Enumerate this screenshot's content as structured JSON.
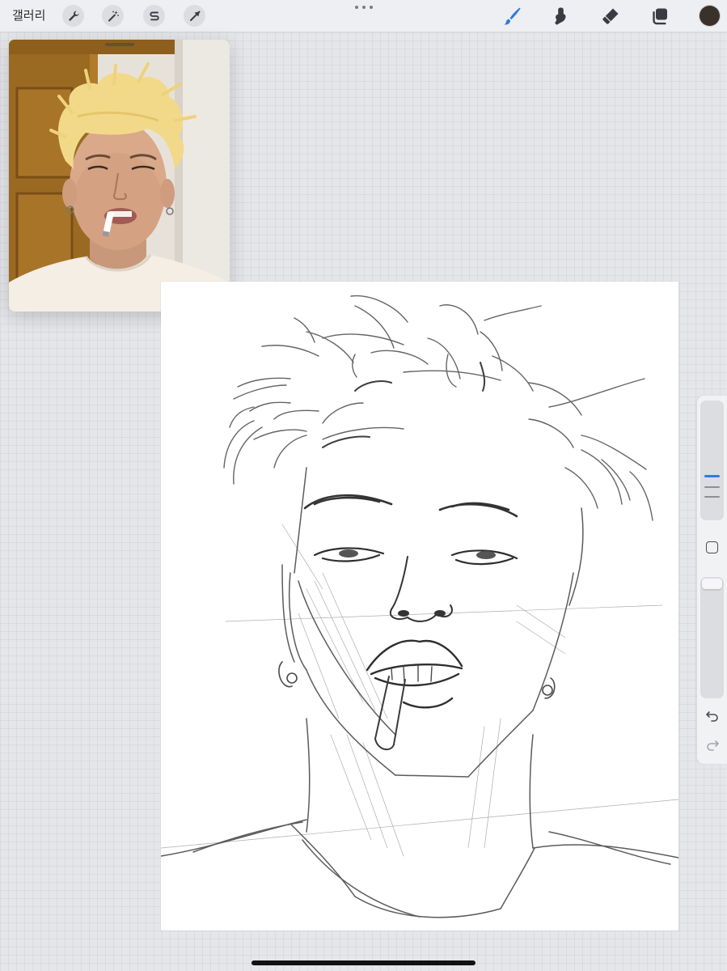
{
  "topbar": {
    "gallery_label": "갤러리",
    "left_tools": [
      "wrench-icon",
      "magic-wand-icon",
      "selection-s-icon",
      "transform-arrow-icon"
    ],
    "right_tools": [
      "brush-icon",
      "smudge-icon",
      "eraser-icon",
      "layers-icon"
    ],
    "active_tool": "brush-icon",
    "current_color": "#3a312b",
    "accent_color": "#2f7be0"
  },
  "reference": {
    "content": "photo-reference"
  },
  "canvas": {
    "content": "pencil-sketch"
  },
  "sidebar": {
    "brush_size_level": 0.45,
    "opacity_level": 1.0,
    "controls": [
      "brush-size-slider",
      "modify-button",
      "opacity-slider",
      "undo-icon",
      "redo-icon"
    ]
  }
}
